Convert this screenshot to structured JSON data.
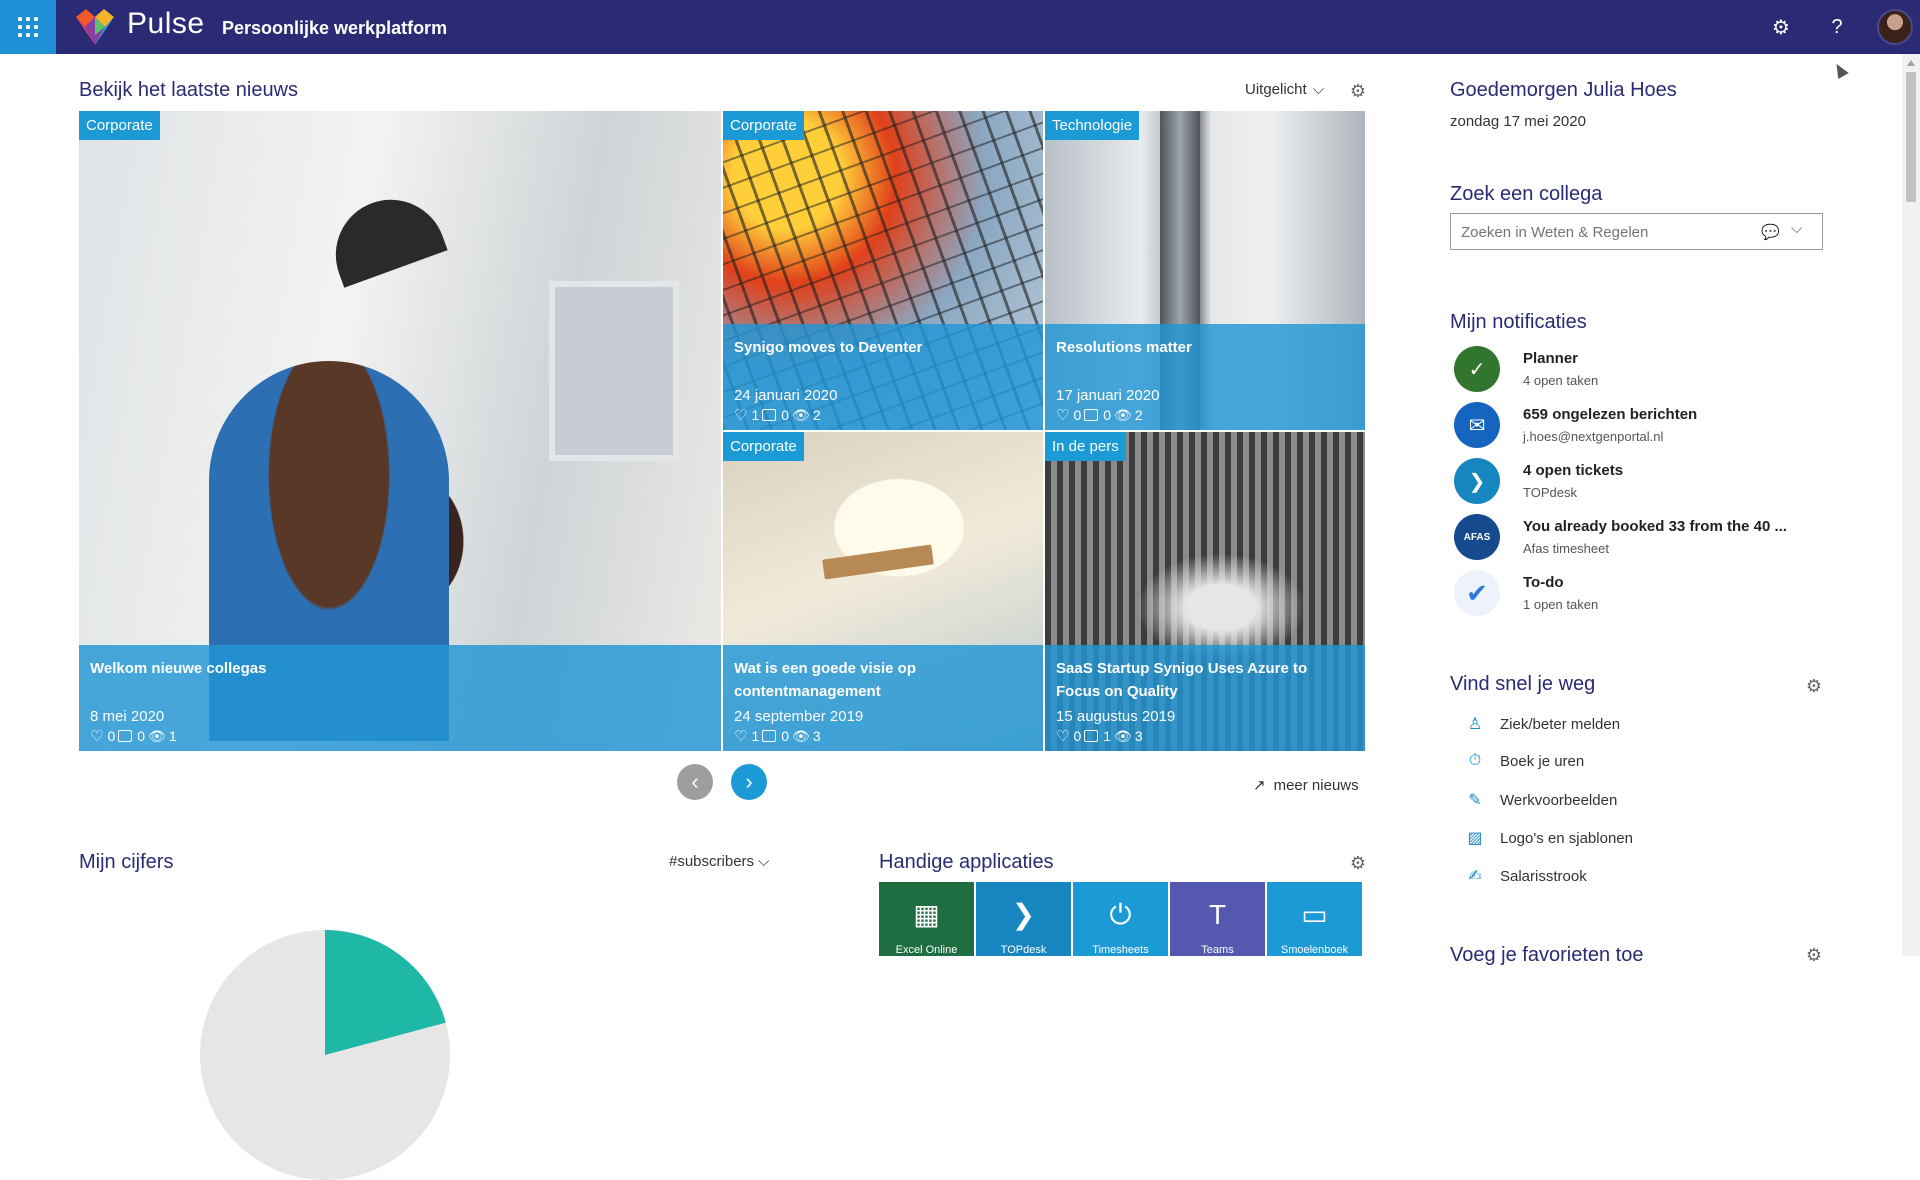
{
  "app": {
    "brand": "Pulse",
    "subtitle": "Persoonlijke werkplatform"
  },
  "news": {
    "title": "Bekijk het laatste nieuws",
    "filter": "Uitgelicht",
    "more": "meer nieuws",
    "items": [
      {
        "category": "Corporate",
        "title": "Welkom nieuwe collegas",
        "date": "8 mei 2020",
        "likes": "0",
        "comments": "0",
        "views": "1"
      },
      {
        "category": "Corporate",
        "title": "Synigo moves to Deventer",
        "date": "24 januari 2020",
        "likes": "1",
        "comments": "0",
        "views": "2"
      },
      {
        "category": "Technologie",
        "title": "Resolutions matter",
        "date": "17 januari 2020",
        "likes": "0",
        "comments": "0",
        "views": "2"
      },
      {
        "category": "Corporate",
        "title": "Wat is een goede visie op contentmanagement",
        "date": "24 september 2019",
        "likes": "1",
        "comments": "0",
        "views": "3"
      },
      {
        "category": "In de pers",
        "title": "SaaS Startup Synigo Uses Azure to Focus on Quality",
        "date": "15 augustus 2019",
        "likes": "0",
        "comments": "1",
        "views": "3"
      }
    ]
  },
  "cijfers": {
    "title": "Mijn cijfers",
    "filter": "#subscribers"
  },
  "apps": {
    "title": "Handige applicaties",
    "items": [
      {
        "label": "Excel Online",
        "icon": "excel-icon",
        "color": "#1e6e42"
      },
      {
        "label": "TOPdesk",
        "icon": "topdesk-icon",
        "color": "#1786c0"
      },
      {
        "label": "Timesheets",
        "icon": "power-icon",
        "color": "#1b9ad6"
      },
      {
        "label": "Teams",
        "icon": "teams-icon",
        "color": "#5558af"
      },
      {
        "label": "Smoelenboek",
        "icon": "contact-card-icon",
        "color": "#1b9ad6"
      }
    ]
  },
  "greeting": {
    "title": "Goedemorgen Julia Hoes",
    "date": "zondag 17 mei 2020"
  },
  "colleague": {
    "title": "Zoek een collega",
    "placeholder": "Zoeken in Weten & Regelen"
  },
  "notifications": {
    "title": "Mijn notificaties",
    "items": [
      {
        "title": "Planner",
        "sub": "4 open taken",
        "icon": "planner-icon",
        "color": "#31752f"
      },
      {
        "title": "659 ongelezen berichten",
        "sub": "j.hoes@nextgenportal.nl",
        "icon": "mail-icon",
        "color": "#1565c0"
      },
      {
        "title": "4 open tickets",
        "sub": "TOPdesk",
        "icon": "topdesk-icon",
        "color": "#1786c0"
      },
      {
        "title": "You already booked 33 from the 40 ...",
        "sub": "Afas timesheet",
        "icon": "afas-icon",
        "color": "#164a8e"
      },
      {
        "title": "To-do",
        "sub": "1 open taken",
        "icon": "check-icon",
        "color": "#eef3fb"
      }
    ]
  },
  "quicklinks": {
    "title": "Vind snel je weg",
    "items": [
      {
        "label": "Ziek/beter melden",
        "icon": "person-icon"
      },
      {
        "label": "Boek je uren",
        "icon": "stopwatch-icon"
      },
      {
        "label": "Werkvoorbeelden",
        "icon": "edit-icon"
      },
      {
        "label": "Logo's en sjablonen",
        "icon": "image-icon"
      },
      {
        "label": "Salarisstrook",
        "icon": "pen-icon"
      }
    ]
  },
  "favorites": {
    "title": "Voeg je favorieten toe"
  },
  "colors": {
    "topbar": "#2b2a75",
    "accent": "#1b9ad6",
    "heading": "#2b2a75"
  }
}
